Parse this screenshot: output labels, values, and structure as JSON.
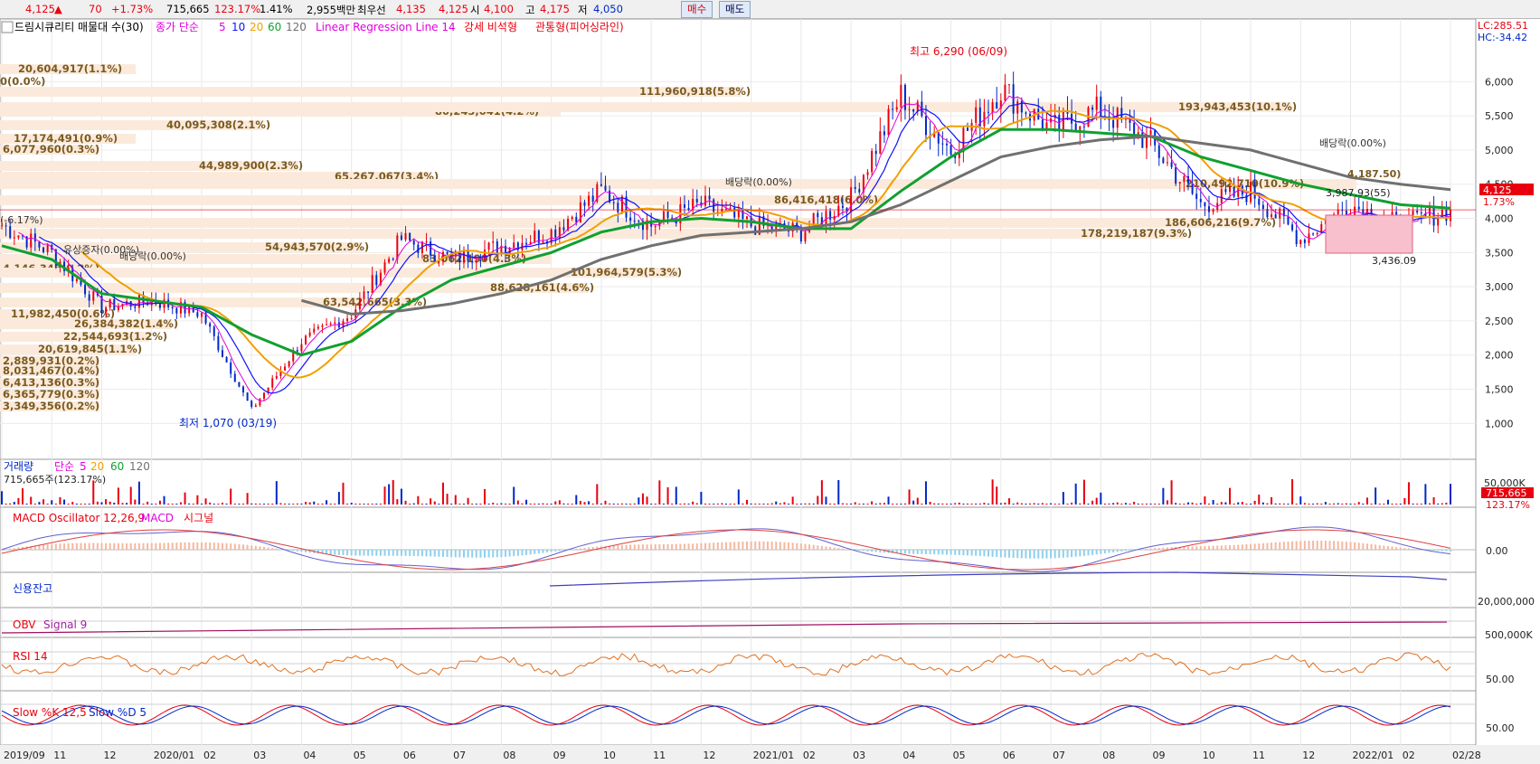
{
  "topbar": {
    "price": "4,125",
    "change": "70",
    "change_pct": "+1.73%",
    "volume": "715,665",
    "volume_ratio": "123.17%",
    "turnover_pct": "1.41%",
    "amount": "2,955백만",
    "best_ask_label": "최우선",
    "best_ask": "4,135",
    "best_bid": "4,125",
    "open_label": "시",
    "open": "4,100",
    "high_label": "고",
    "high": "4,175",
    "low_label": "저",
    "low": "4,050",
    "buy_label": "매수",
    "sell_label": "매도"
  },
  "legend": {
    "stock": "드림시큐리티 매물대 수(30)",
    "ma_label": "종가 단순",
    "ma_periods": [
      "5",
      "10",
      "20",
      "60",
      "120"
    ],
    "lr": "Linear Regression Line 14",
    "strong": "강세 비석형",
    "pierce": "관통형(피어싱라인)"
  },
  "right_top": {
    "lc": "LC:285.51",
    "hc": "HC:-34.42"
  },
  "price_axis": {
    "ticks": [
      "6,000",
      "5,500",
      "5,000",
      "4,500",
      "4,000",
      "3,500",
      "3,000",
      "2,500",
      "2,000",
      "1,500",
      "1,000"
    ],
    "values": [
      6000,
      5500,
      5000,
      4500,
      4000,
      3500,
      3000,
      2500,
      2000,
      1500,
      1000
    ],
    "current": "4,125",
    "current_pct": "1.73%"
  },
  "annotations": {
    "high": "최고 6,290 (06/09)",
    "low": "최저 1,070 (03/19)",
    "box_label": "3,436.09",
    "box_mid": "3,987.93(55)",
    "div_mid": "배당락(0.00%)",
    "div_right": "배당락(0.00%)",
    "div_left": "배당락(0.00%)",
    "cap_left": "유상증자(0.00%)",
    "left_pct": "(-6.17%)",
    "right_val": "4,187.50)"
  },
  "volume_profile": [
    {
      "text": "20,604,917(1.1%)"
    },
    {
      "text": "0(0.0%)"
    },
    {
      "text": "111,960,918(5.8%)"
    },
    {
      "text": "80,243,041(4.2%)"
    },
    {
      "text": "40,095,308(2.1%)"
    },
    {
      "text": "17,174,491(0.9%)"
    },
    {
      "text": "6,077,960(0.3%)"
    },
    {
      "text": "193,943,453(10.1%)"
    },
    {
      "text": "44,989,900(2.3%)"
    },
    {
      "text": "65,267,067(3.4%)"
    },
    {
      "text": "210,492,710(10.9%)"
    },
    {
      "text": "86,416,418(6.0%)"
    },
    {
      "text": "186,606,216(9.7%)"
    },
    {
      "text": "178,219,187(9.3%)"
    },
    {
      "text": "54,943,570(2.9%)"
    },
    {
      "text": "83,062,190(4.3%)"
    },
    {
      "text": "4,146,348(0.2%)"
    },
    {
      "text": "101,964,579(5.3%)"
    },
    {
      "text": "88,628,161(4.6%)"
    },
    {
      "text": "63,542,665(3.3%)"
    },
    {
      "text": "11,982,450(0.6%)"
    },
    {
      "text": "26,384,382(1.4%)"
    },
    {
      "text": "22,544,693(1.2%)"
    },
    {
      "text": "20,619,845(1.1%)"
    },
    {
      "text": "2,889,931(0.2%)"
    },
    {
      "text": "8,031,467(0.4%)"
    },
    {
      "text": "6,413,136(0.3%)"
    },
    {
      "text": "6,365,779(0.3%)"
    },
    {
      "text": "3,349,356(0.2%)"
    }
  ],
  "volume_panel": {
    "title": "거래량",
    "ma_label": "단순",
    "periods": [
      "5",
      "20",
      "60",
      "120"
    ],
    "value": "715,665주(123.17%)",
    "axis": "50,000K",
    "current": "715,665",
    "current_pct": "123.17%"
  },
  "macd": {
    "title": "MACD Oscillator 12,26,9",
    "macd": "MACD",
    "signal": "시그널",
    "axis": "0.00"
  },
  "credit": {
    "title": "신용잔고",
    "axis": "20,000,000"
  },
  "obv": {
    "title": "OBV",
    "signal": "Signal 9",
    "axis": "500,000K"
  },
  "rsi": {
    "title": "RSI 14",
    "axis": "50.00"
  },
  "slow": {
    "k": "Slow %K 12,5",
    "d": "Slow %D 5",
    "axis": "50.00"
  },
  "xaxis": [
    "2019/09",
    "11",
    "12",
    "2020/01",
    "02",
    "03",
    "04",
    "05",
    "06",
    "07",
    "08",
    "09",
    "10",
    "11",
    "12",
    "2021/01",
    "02",
    "03",
    "04",
    "05",
    "06",
    "07",
    "08",
    "09",
    "10",
    "11",
    "12",
    "2022/01",
    "02",
    "02/28"
  ],
  "colors": {
    "up": "#e8000f",
    "down": "#0028c8",
    "ma5": "#e000e0",
    "ma10": "#1010ff",
    "ma20": "#f0a000",
    "ma60": "#10a030",
    "ma120": "#707070",
    "profile": "#fbeadb"
  },
  "chart_data": {
    "type": "line",
    "title": "드림시큐리티",
    "xlabel": "",
    "ylabel": "",
    "ylim": [
      700,
      6600
    ],
    "categories": [
      "2019/09",
      "11",
      "12",
      "2020/01",
      "02",
      "03",
      "04",
      "05",
      "06",
      "07",
      "08",
      "09",
      "10",
      "11",
      "12",
      "2021/01",
      "02",
      "03",
      "04",
      "05",
      "06",
      "07",
      "08",
      "09",
      "10",
      "11",
      "12",
      "2022/01",
      "02",
      "02/28"
    ],
    "series": [
      {
        "name": "종가",
        "values": [
          3900,
          3500,
          2700,
          2800,
          2600,
          1200,
          2200,
          2600,
          3700,
          3400,
          3600,
          3800,
          4400,
          3900,
          4200,
          3900,
          3800,
          4300,
          5800,
          5000,
          5900,
          5300,
          5600,
          5100,
          4200,
          4400,
          3700,
          4200,
          3900,
          4125
        ]
      },
      {
        "name": "60",
        "values": [
          3600,
          3400,
          2900,
          2800,
          2700,
          2300,
          2000,
          2200,
          2700,
          3100,
          3300,
          3500,
          3800,
          3950,
          4000,
          3950,
          3850,
          3850,
          4400,
          4900,
          5300,
          5300,
          5250,
          5200,
          4900,
          4700,
          4500,
          4350,
          4200,
          4150
        ]
      },
      {
        "name": "120",
        "values": [
          null,
          null,
          null,
          null,
          null,
          null,
          2800,
          2600,
          2650,
          2750,
          2900,
          3100,
          3400,
          3600,
          3750,
          3800,
          3850,
          3950,
          4200,
          4550,
          4900,
          5050,
          5150,
          5200,
          5100,
          5000,
          4800,
          4600,
          4500,
          4420
        ]
      }
    ]
  }
}
